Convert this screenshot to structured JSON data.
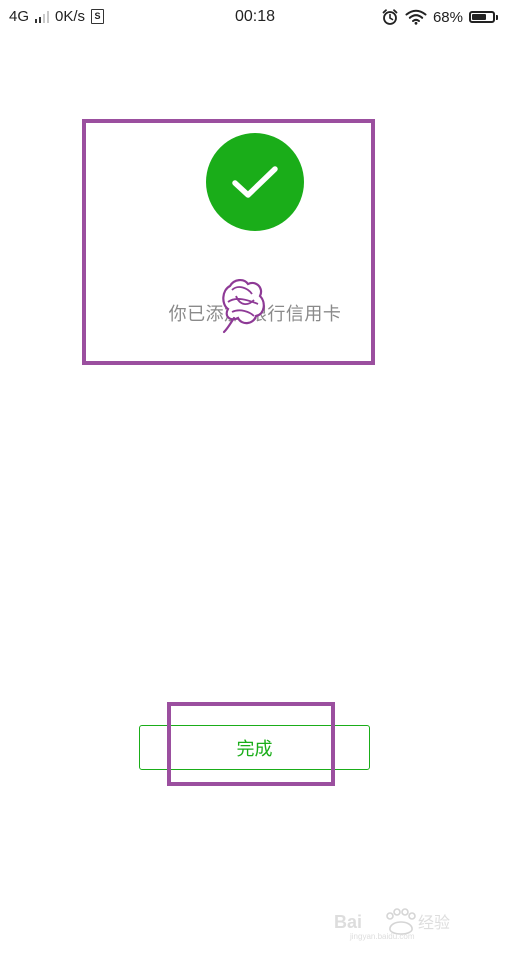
{
  "status_bar": {
    "network": "4G",
    "speed": "0K/s",
    "sim_icon_letter": "S",
    "time": "00:18",
    "battery_percent": "68%",
    "battery_level": 0.68,
    "icons": [
      "signal-icon",
      "sim-icon",
      "alarm-icon",
      "wifi-icon",
      "battery-icon"
    ]
  },
  "result": {
    "icon": "check-icon",
    "message": "你已添加  银行信用卡"
  },
  "actions": {
    "done_label": "完成"
  },
  "colors": {
    "success_green": "#1aad19",
    "message_gray": "#8a8a8a",
    "annotation_purple": "#9b4f9f"
  }
}
